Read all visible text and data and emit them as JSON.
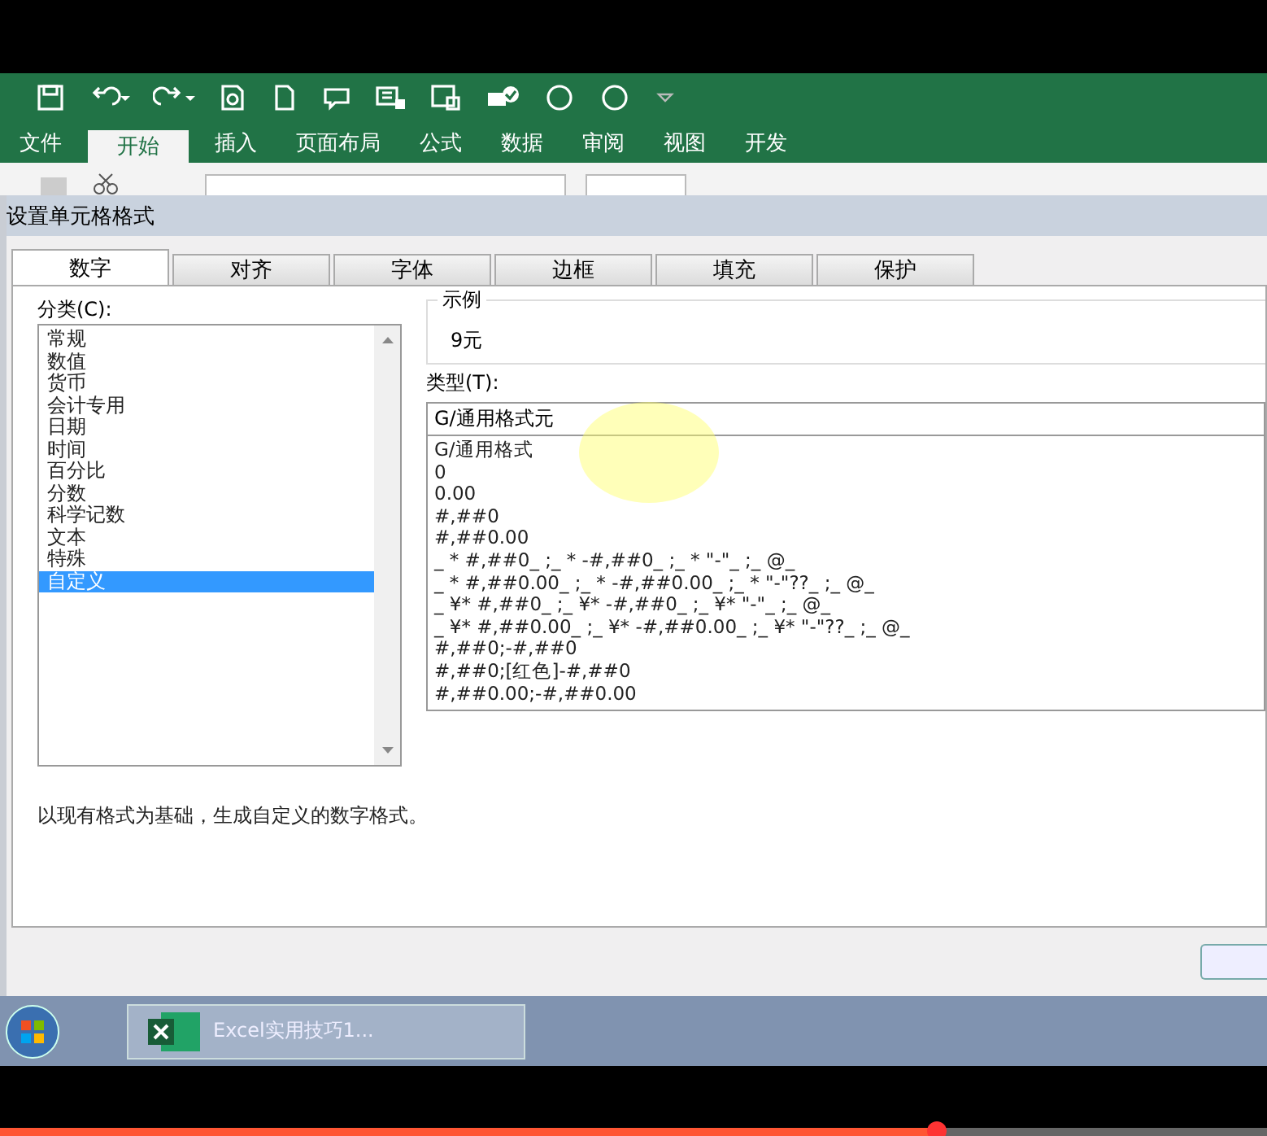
{
  "ribbon_tabs": [
    {
      "label": "文件",
      "selected": false
    },
    {
      "label": "开始",
      "selected": true
    },
    {
      "label": "插入",
      "selected": false
    },
    {
      "label": "页面布局",
      "selected": false
    },
    {
      "label": "公式",
      "selected": false
    },
    {
      "label": "数据",
      "selected": false
    },
    {
      "label": "审阅",
      "selected": false
    },
    {
      "label": "视图",
      "selected": false
    },
    {
      "label": "开发",
      "selected": false
    }
  ],
  "dialog": {
    "title": "设置单元格格式",
    "tabs": [
      {
        "label": "数字",
        "selected": true
      },
      {
        "label": "对齐",
        "selected": false
      },
      {
        "label": "字体",
        "selected": false
      },
      {
        "label": "边框",
        "selected": false
      },
      {
        "label": "填充",
        "selected": false
      },
      {
        "label": "保护",
        "selected": false
      }
    ],
    "category_label": "分类(C):",
    "categories": [
      {
        "label": "常规",
        "selected": false
      },
      {
        "label": "数值",
        "selected": false
      },
      {
        "label": "货币",
        "selected": false
      },
      {
        "label": "会计专用",
        "selected": false
      },
      {
        "label": "日期",
        "selected": false
      },
      {
        "label": "时间",
        "selected": false
      },
      {
        "label": "百分比",
        "selected": false
      },
      {
        "label": "分数",
        "selected": false
      },
      {
        "label": "科学记数",
        "selected": false
      },
      {
        "label": "文本",
        "selected": false
      },
      {
        "label": "特殊",
        "selected": false
      },
      {
        "label": "自定义",
        "selected": true
      }
    ],
    "sample": {
      "legend": "示例",
      "value": "9元"
    },
    "type_label": "类型(T):",
    "type_input": {
      "value": "G/通用格式元"
    },
    "type_list": [
      "G/通用格式",
      "0",
      "0.00",
      "#,##0",
      "#,##0.00",
      "_ * #,##0_ ;_ * -#,##0_ ;_ * \"-\"_ ;_ @_",
      "_ * #,##0.00_ ;_ * -#,##0.00_ ;_ * \"-\"??_ ;_ @_",
      "_ ¥* #,##0_ ;_ ¥* -#,##0_ ;_ ¥* \"-\"_ ;_ @_",
      "_ ¥* #,##0.00_ ;_ ¥* -#,##0.00_ ;_ ¥* \"-\"??_ ;_ @_",
      "#,##0;-#,##0",
      "#,##0;[红色]-#,##0",
      "#,##0.00;-#,##0.00"
    ],
    "description": "以现有格式为基础，生成自定义的数字格式。"
  },
  "taskbar": {
    "item": {
      "label": "Excel实用技巧1..."
    }
  },
  "video_progress": {
    "level": 0.74
  }
}
